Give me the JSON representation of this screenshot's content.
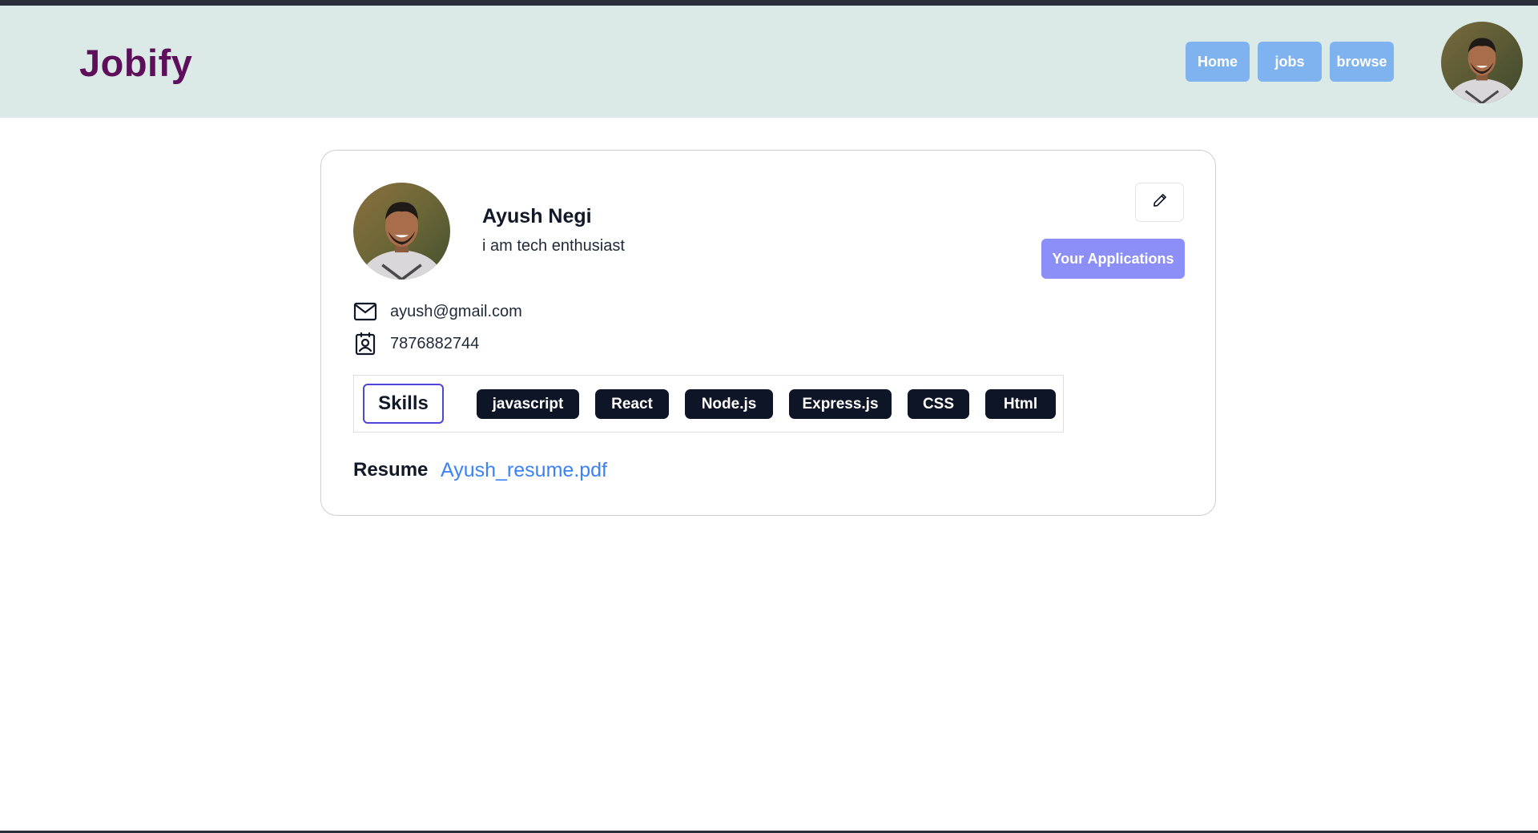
{
  "header": {
    "brand": "Jobify",
    "nav": [
      {
        "label": "Home"
      },
      {
        "label": "jobs"
      },
      {
        "label": "browse"
      }
    ],
    "avatar_alt": "user avatar"
  },
  "profile": {
    "name": "Ayush Negi",
    "bio": "i am tech enthusiast",
    "edit_icon": "pencil-icon",
    "applications_label": "Your Applications",
    "email": "ayush@gmail.com",
    "phone": "7876882744",
    "skills_label": "Skills",
    "skills": [
      "javascript",
      "React",
      "Node.js",
      "Express.js",
      "CSS",
      "Html"
    ],
    "resume_label": "Resume",
    "resume_file": "Ayush_resume.pdf"
  },
  "colors": {
    "brand": "#5e0f5b",
    "navbar_bg": "#dbeae6",
    "nav_button": "#7fb3ef",
    "applications_button": "#8b8ff7",
    "skill_badge": "#0e1526",
    "skills_label_border": "#4d46d8",
    "link": "#3b82f6"
  }
}
